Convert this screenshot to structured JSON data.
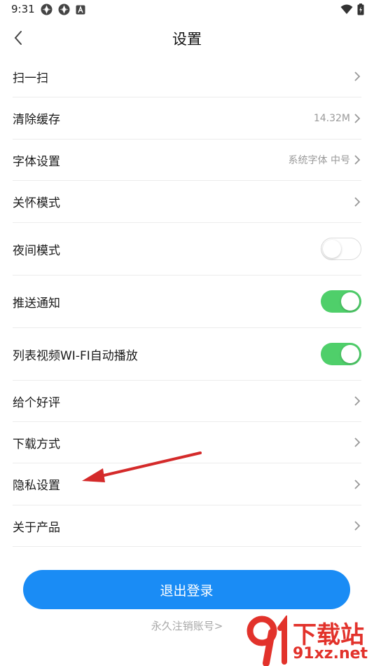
{
  "status_bar": {
    "time": "9:31",
    "left_icons": [
      "notification-icon",
      "notification-icon",
      "app-icon"
    ],
    "right_icons": [
      "wifi-icon",
      "battery-icon"
    ]
  },
  "header": {
    "title": "设置",
    "back_icon": "chevron-left-icon"
  },
  "settings": {
    "items": [
      {
        "label": "扫一扫",
        "type": "nav"
      },
      {
        "label": "清除缓存",
        "type": "nav",
        "value": "14.32M"
      },
      {
        "label": "字体设置",
        "type": "nav",
        "value": "系统字体 中号"
      },
      {
        "label": "关怀模式",
        "type": "nav"
      },
      {
        "label": "夜间模式",
        "type": "toggle",
        "on": false
      },
      {
        "label": "推送通知",
        "type": "toggle",
        "on": true
      },
      {
        "label": "列表视频WI-FI自动播放",
        "type": "toggle",
        "on": true
      },
      {
        "label": "给个好评",
        "type": "nav"
      },
      {
        "label": "下载方式",
        "type": "nav"
      },
      {
        "label": "隐私设置",
        "type": "nav"
      },
      {
        "label": "关于产品",
        "type": "nav"
      }
    ]
  },
  "logout_label": "退出登录",
  "cancel_account_label": "永久注销账号>",
  "watermark": {
    "text": "下载站",
    "url": "91xz.net"
  },
  "colors": {
    "primary": "#1a8cf5",
    "toggle_on": "#4fcf6a",
    "annotation_arrow": "#d42a2a"
  }
}
